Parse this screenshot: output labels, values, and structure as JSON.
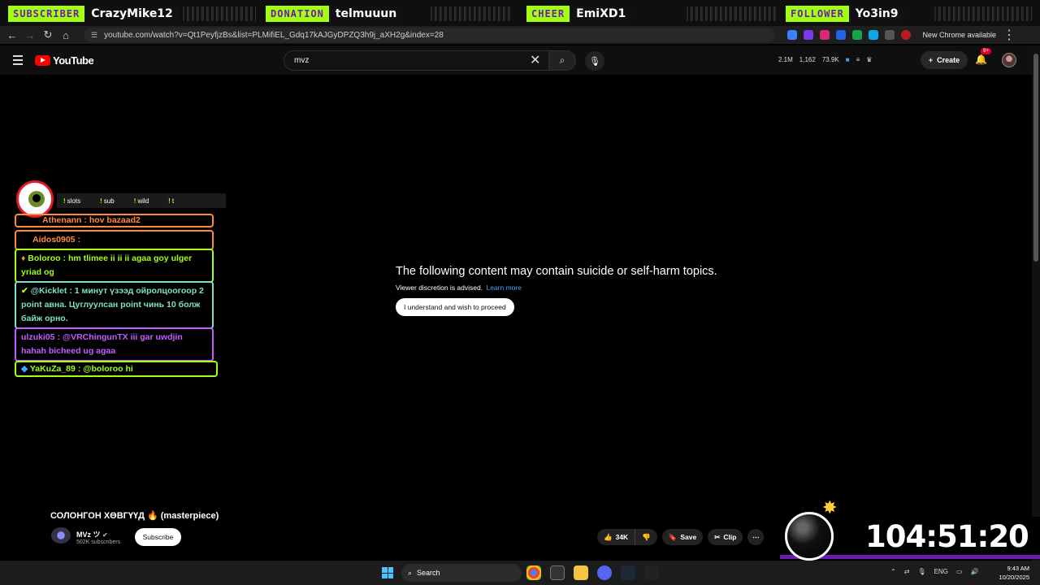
{
  "alerts": [
    {
      "type": "SUBSCRIBER",
      "name": "CrazyMike12"
    },
    {
      "type": "DONATION",
      "name": "telmuuun"
    },
    {
      "type": "CHEER",
      "name": "EmiXD1"
    },
    {
      "type": "FOLLOWER",
      "name": "Yo3in9"
    }
  ],
  "browser": {
    "url": "youtube.com/watch?v=Qt1PeyfjzBs&list=PLMifiEL_Gdq17kAJGyDPZQ3h9j_aXH2g&index=28",
    "new_chrome": "New Chrome available"
  },
  "header": {
    "logo_text": "YouTube",
    "search_value": "mvz",
    "stats": [
      "2.1M",
      "1,162",
      "73.9K"
    ],
    "create_label": "Create",
    "notif_badge": "9+"
  },
  "warning": {
    "title": "The following content may contain suicide or self-harm topics.",
    "subtitle": "Viewer discretion is advised.",
    "learn_more": "Learn more",
    "proceed": "I understand and wish to proceed"
  },
  "chat": {
    "commands": [
      "slots",
      "sub",
      "wild",
      "t"
    ],
    "messages": [
      {
        "user": "Athenann",
        "text": ": hov bazaad2",
        "color": "#ff8a3d"
      },
      {
        "user": "Aidos0905",
        "text": ":",
        "color": "#ff8a3d"
      },
      {
        "user": "Boloroo",
        "text": ": hm tlimee ii ii ii agaa goy ulger yriad og",
        "color": "#a3ff12"
      },
      {
        "user": "@Kicklet",
        "text": ": 1 минут үзээд ойролцоогоор 2 point авна. Цуглуулсан point чинь 10 болж байж орно.",
        "color": "#7fe0c8"
      },
      {
        "user": "ulzuki05",
        "text": ": @VRChingunTX iii gar uwdjin hahah bicheed ug agaa",
        "color": "#c45cff"
      },
      {
        "user": "YaKuZa_89",
        "text": ": @boloroo hi",
        "color": "#a3ff12"
      }
    ]
  },
  "video": {
    "title": "СОЛОНГОН ХӨВГҮҮД 🔥 (masterpiece)",
    "channel": "MVz ツ",
    "subscribers": "502K subscribers",
    "subscribe": "Subscribe",
    "likes": "34K",
    "save": "Save",
    "clip": "Clip"
  },
  "timer": "104:51:20",
  "taskbar": {
    "search": "Search",
    "lang": "ENG",
    "time": "9:43 AM",
    "date": "10/20/2025"
  },
  "colors": {
    "accent_green": "#a3ff12",
    "accent_purple": "#6a1bb0",
    "yt_red": "#ff0000",
    "link_blue": "#3ea6ff"
  }
}
